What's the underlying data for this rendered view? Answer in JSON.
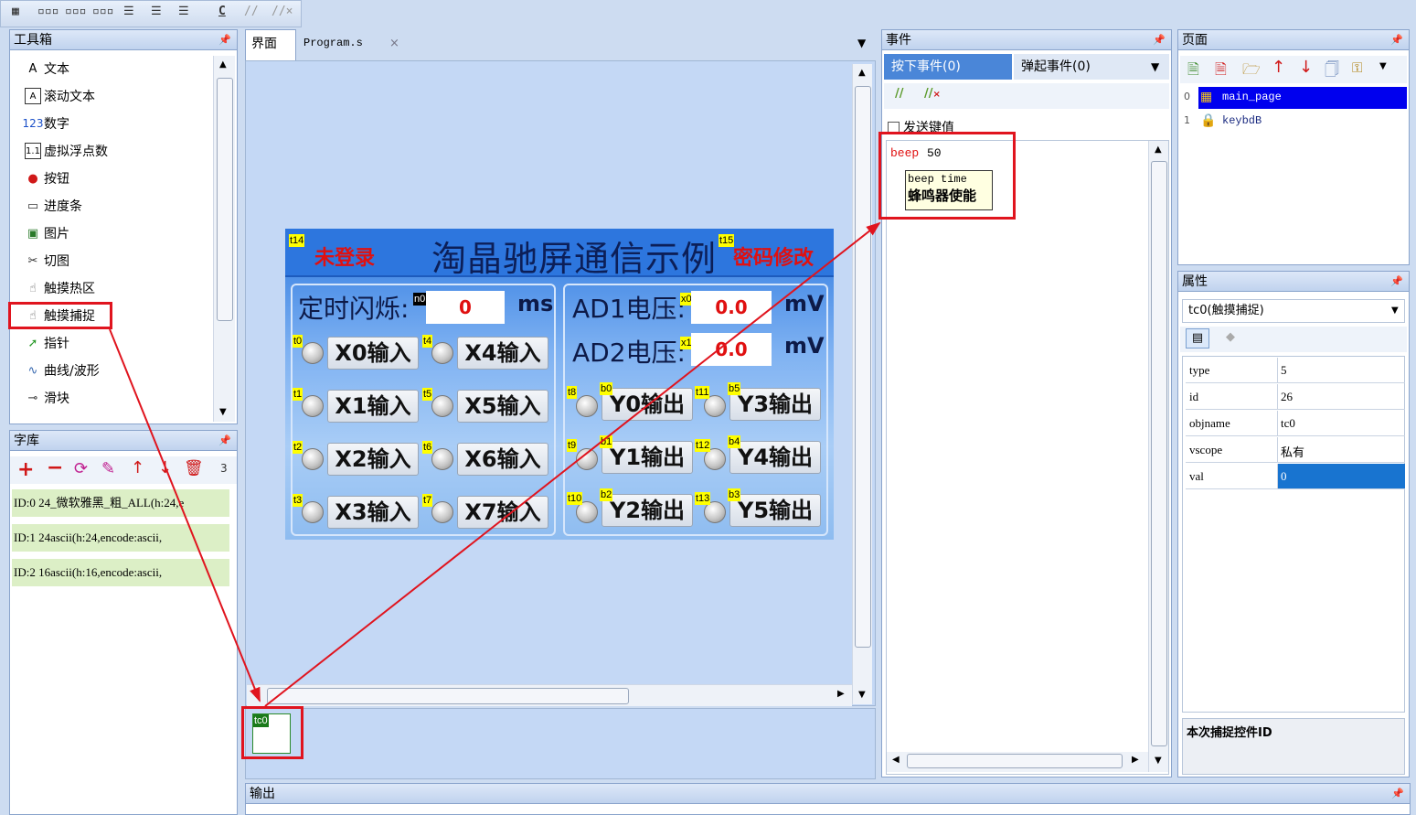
{
  "toolbar": {
    "icons": [
      "grid-icon",
      "align-h-icon",
      "align-h2-icon",
      "align-h3-icon",
      "align-v-icon",
      "align-v2-icon",
      "align-v3-icon",
      "c-icon",
      "comment-icon",
      "uncomment-icon"
    ],
    "c_label": "C"
  },
  "toolbox": {
    "title": "工具箱",
    "pin": "🗕",
    "items": [
      {
        "label": "文本",
        "icon": "A"
      },
      {
        "label": "滚动文本",
        "icon": "A"
      },
      {
        "label": "数字",
        "icon": "123"
      },
      {
        "label": "虚拟浮点数",
        "icon": "1.1"
      },
      {
        "label": "按钮",
        "icon": "●"
      },
      {
        "label": "进度条",
        "icon": "▭"
      },
      {
        "label": "图片",
        "icon": "▣"
      },
      {
        "label": "切图",
        "icon": "✂"
      },
      {
        "label": "触摸热区",
        "icon": "☝"
      },
      {
        "label": "触摸捕捉",
        "icon": "☝"
      },
      {
        "label": "指针",
        "icon": "➚"
      },
      {
        "label": "曲线/波形",
        "icon": "∿"
      },
      {
        "label": "滑块",
        "icon": "⊸"
      }
    ]
  },
  "fontlib": {
    "title": "字库",
    "count": "3",
    "rows": [
      "ID:0   24_微软雅黑_粗_ALL(h:24,e",
      "ID:1   24ascii(h:24,encode:ascii,",
      "ID:2   16ascii(h:16,encode:ascii,"
    ]
  },
  "editor": {
    "tabs": [
      "界面",
      "Program.s"
    ],
    "close": "×"
  },
  "hmi": {
    "title": "淘晶驰屏通信示例",
    "login_tag": "t14",
    "login_text": "未登录",
    "pwd_tag": "t15",
    "pwd_text": "密码修改",
    "timer_label": "定时闪烁:",
    "timer_tag": "n0",
    "timer_value": "0",
    "timer_unit": "ms",
    "ad1_label": "AD1电压:",
    "ad1_tag": "x0",
    "ad1_value": "0.0",
    "ad1_unit": "mV",
    "ad2_label": "AD2电压:",
    "ad2_tag": "x1",
    "ad2_value": "0.0",
    "ad2_unit": "mV",
    "inputs": [
      {
        "tag": "t0",
        "label": "X0输入"
      },
      {
        "tag": "t4",
        "label": "X4输入"
      },
      {
        "tag": "t1",
        "label": "X1输入"
      },
      {
        "tag": "t5",
        "label": "X5输入"
      },
      {
        "tag": "t2",
        "label": "X2输入"
      },
      {
        "tag": "t6",
        "label": "X6输入"
      },
      {
        "tag": "t3",
        "label": "X3输入"
      },
      {
        "tag": "t7",
        "label": "X7输入"
      }
    ],
    "outputs": [
      {
        "led": "t8",
        "tag": "b0",
        "label": "Y0输出"
      },
      {
        "led": "t11",
        "tag": "b5",
        "label": "Y3输出"
      },
      {
        "led": "t9",
        "tag": "b1",
        "label": "Y1输出"
      },
      {
        "led": "t12",
        "tag": "b4",
        "label": "Y4输出"
      },
      {
        "led": "t10",
        "tag": "b2",
        "label": "Y2输出"
      },
      {
        "led": "t13",
        "tag": "b3",
        "label": "Y5输出"
      }
    ]
  },
  "hidden_area": {
    "tag": "tc0"
  },
  "events": {
    "title": "事件",
    "tab_press": "按下事件(0)",
    "tab_release": "弹起事件(0)",
    "send_key": "发送键值",
    "code_keyword": "beep",
    "code_value": "50",
    "tip_line1": "beep time",
    "tip_line2": "蜂鸣器使能"
  },
  "pages": {
    "title": "页面",
    "items": [
      {
        "index": "0",
        "name": "main_page"
      },
      {
        "index": "1",
        "name": "keybdB"
      }
    ]
  },
  "props": {
    "title": "属性",
    "selected": "tc0(触摸捕捉)",
    "rows": [
      {
        "key": "type",
        "value": "5"
      },
      {
        "key": "id",
        "value": "26"
      },
      {
        "key": "objname",
        "value": "tc0"
      },
      {
        "key": "vscope",
        "value": "私有"
      },
      {
        "key": "val",
        "value": "0"
      }
    ],
    "desc": "本次捕捉控件ID"
  },
  "output": {
    "title": "输出"
  }
}
